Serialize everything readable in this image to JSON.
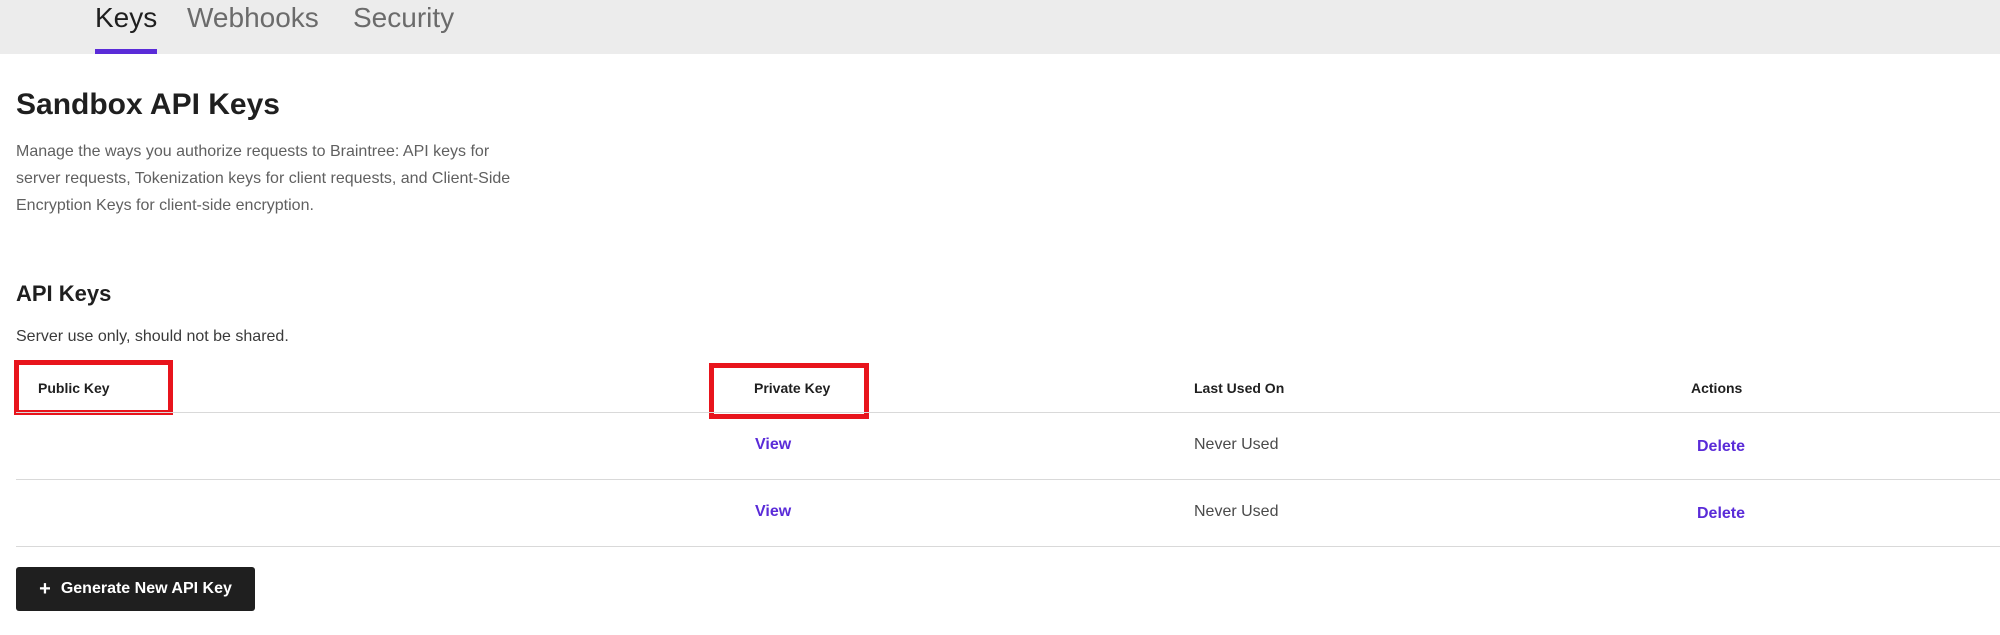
{
  "tabs": [
    {
      "label": "Keys",
      "active": true
    },
    {
      "label": "Webhooks",
      "active": false
    },
    {
      "label": "Security",
      "active": false
    }
  ],
  "page": {
    "title": "Sandbox API Keys",
    "description": "Manage the ways you authorize requests to Braintree: API keys for server requests, Tokenization keys for client requests, and Client-Side Encryption Keys for client-side encryption."
  },
  "api_keys": {
    "title": "API Keys",
    "description": "Server use only, should not be shared.",
    "columns": {
      "public_key": "Public Key",
      "private_key": "Private Key",
      "last_used_on": "Last Used On",
      "actions": "Actions"
    },
    "rows": [
      {
        "public_key": "",
        "private_key_action": "View",
        "last_used_on": "Never Used",
        "action": "Delete"
      },
      {
        "public_key": "",
        "private_key_action": "View",
        "last_used_on": "Never Used",
        "action": "Delete"
      }
    ],
    "generate_button": {
      "label": "Generate New API Key",
      "icon": "plus-icon"
    }
  },
  "colors": {
    "accent": "#5a2bd8",
    "highlight": "#e8141c",
    "tabbar_bg": "#ececec",
    "button_bg": "#1f1f1f"
  }
}
